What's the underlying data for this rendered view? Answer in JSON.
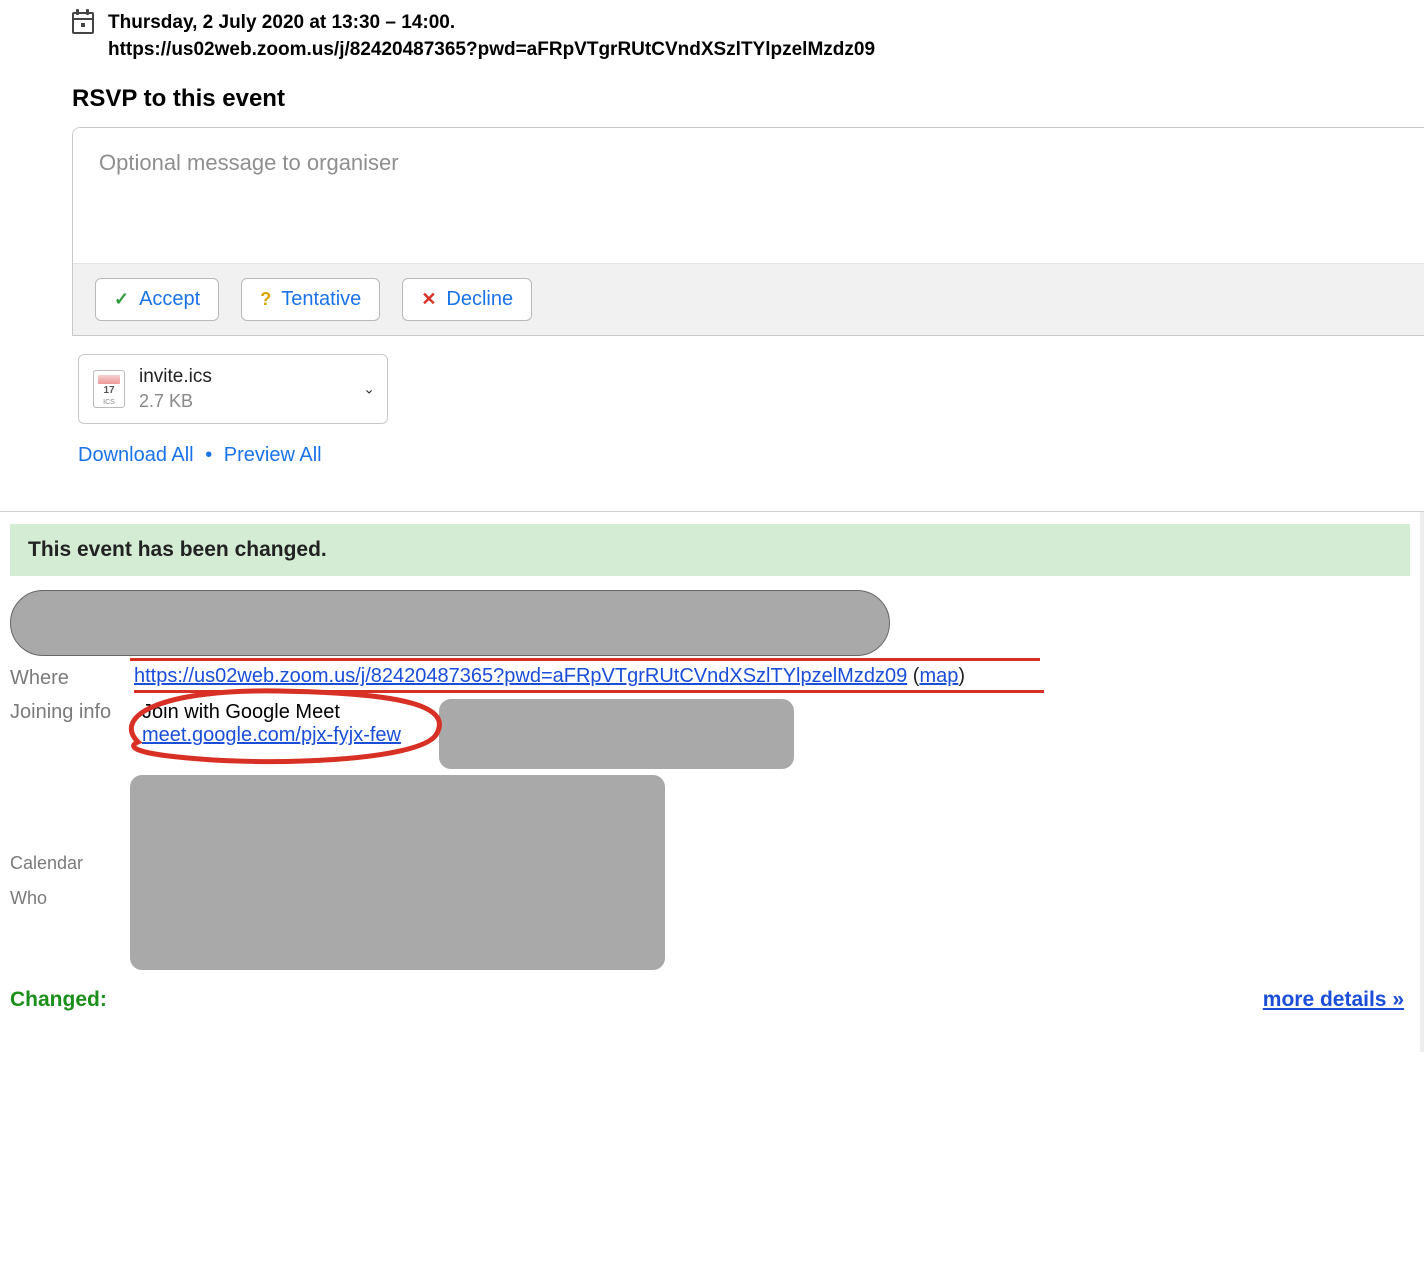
{
  "event": {
    "date_text": "Thursday, 2 July 2020 at 13:30 – 14:00.",
    "location_text": "https://us02web.zoom.us/j/82420487365?pwd=aFRpVTgrRUtCVndXSzlTYlpzelMzdz09"
  },
  "rsvp": {
    "heading": "RSVP to this event",
    "placeholder": "Optional message to organiser",
    "accept": "Accept",
    "tentative": "Tentative",
    "decline": "Decline"
  },
  "attachment": {
    "name": "invite.ics",
    "size": "2.7 KB",
    "ics_label": "ICS"
  },
  "links": {
    "download_all": "Download All",
    "preview_all": "Preview All"
  },
  "body": {
    "banner": "This event has been changed.",
    "where_label": "Where",
    "zoom_url": "https://us02web.zoom.us/j/82420487365?pwd=aFRpVTgrRUtCVndXSzlTYlpzelMzdz09",
    "map_label": "map",
    "joining_label": "Joining info",
    "join_heading": "Join with Google Meet",
    "meet_url": "meet.google.com/pjx-fyjx-few",
    "calendar_label": "Calendar",
    "who_label": "Who",
    "changed_label": "Changed:",
    "more_details": "more details »"
  }
}
